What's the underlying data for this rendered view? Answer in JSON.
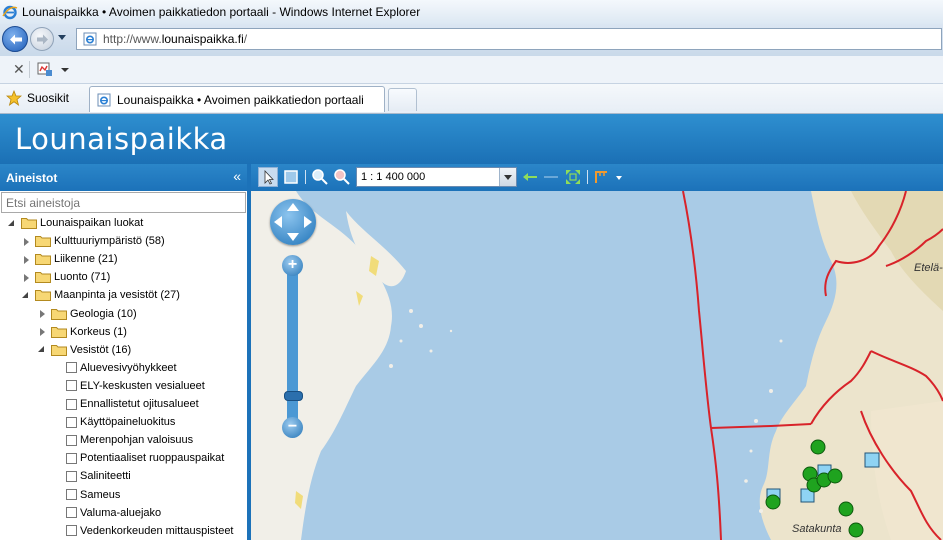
{
  "browser": {
    "window_title": "Lounaispaikka • Avoimen paikkatiedon portaali - Windows Internet Explorer",
    "url_prefix": "http://www.",
    "url_domain": "lounaispaikka.fi",
    "url_suffix": "/",
    "favorites_label": "Suosikit",
    "tab_title": "Lounaispaikka • Avoimen paikkatiedon portaali"
  },
  "app": {
    "logo": "Lounaispaikka"
  },
  "sidebar": {
    "title": "Aineistot",
    "collapse": "«",
    "search_placeholder": "Etsi aineistoja",
    "tree": [
      {
        "label": "Lounaispaikan luokat",
        "level": 0,
        "state": "open",
        "kind": "folder"
      },
      {
        "label": "Kulttuuriympäristö (58)",
        "level": 1,
        "state": "closed",
        "kind": "folder"
      },
      {
        "label": "Liikenne (21)",
        "level": 1,
        "state": "closed",
        "kind": "folder"
      },
      {
        "label": "Luonto (71)",
        "level": 1,
        "state": "closed",
        "kind": "folder"
      },
      {
        "label": "Maanpinta ja vesistöt (27)",
        "level": 1,
        "state": "open",
        "kind": "folder"
      },
      {
        "label": "Geologia (10)",
        "level": 2,
        "state": "closed",
        "kind": "folder"
      },
      {
        "label": "Korkeus (1)",
        "level": 2,
        "state": "closed",
        "kind": "folder"
      },
      {
        "label": "Vesistöt (16)",
        "level": 2,
        "state": "open",
        "kind": "folder"
      },
      {
        "label": "Aluevesivyöhykkeet",
        "level": 3,
        "kind": "layer",
        "checked": false
      },
      {
        "label": "ELY-keskusten vesialueet",
        "level": 3,
        "kind": "layer",
        "checked": false
      },
      {
        "label": "Ennallistetut ojitusalueet",
        "level": 3,
        "kind": "layer",
        "checked": false
      },
      {
        "label": "Käyttöpaineluokitus",
        "level": 3,
        "kind": "layer",
        "checked": false
      },
      {
        "label": "Merenpohjan valoisuus",
        "level": 3,
        "kind": "layer",
        "checked": false
      },
      {
        "label": "Potentiaaliset ruoppauspaikat",
        "level": 3,
        "kind": "layer",
        "checked": false
      },
      {
        "label": "Saliniteetti",
        "level": 3,
        "kind": "layer",
        "checked": false
      },
      {
        "label": "Sameus",
        "level": 3,
        "kind": "layer",
        "checked": false
      },
      {
        "label": "Valuma-aluejako",
        "level": 3,
        "kind": "layer",
        "checked": false
      },
      {
        "label": "Vedenkorkeuden mittauspisteet",
        "level": 3,
        "kind": "layer",
        "checked": false
      }
    ]
  },
  "map_toolbar": {
    "scale_value": "1 : 1 400 000"
  },
  "map": {
    "labels": {
      "region_1": "Etelä-",
      "region_2": "Satakunta"
    },
    "colors": {
      "sea": "#a9cbe6",
      "land": "#e8e2cd",
      "boundary": "#d8232a",
      "point_fill": "#1fa31f",
      "station_fill": "#8fd3f3"
    }
  }
}
